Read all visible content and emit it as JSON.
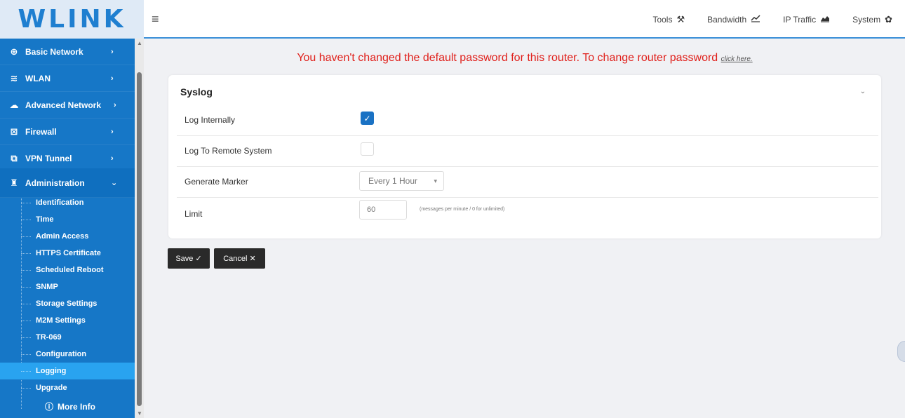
{
  "header": {
    "logo": "WLINK",
    "nav": [
      {
        "label": "Tools",
        "icon": "tools-icon",
        "glyph": "⚒"
      },
      {
        "label": "Bandwidth",
        "icon": "line-chart-icon",
        "glyph": "📈"
      },
      {
        "label": "IP Traffic",
        "icon": "area-chart-icon",
        "glyph": "▟"
      },
      {
        "label": "System",
        "icon": "gear-icon",
        "glyph": "✿"
      }
    ]
  },
  "sidebar": {
    "items": [
      {
        "label": "Basic Network",
        "icon": "globe-icon",
        "glyph": "⊕",
        "chevron": "›"
      },
      {
        "label": "WLAN",
        "icon": "wifi-icon",
        "glyph": "≋",
        "chevron": "›"
      },
      {
        "label": "Advanced Network",
        "icon": "network-icon",
        "glyph": "☁",
        "chevron": "›"
      },
      {
        "label": "Firewall",
        "icon": "firewall-icon",
        "glyph": "⊠",
        "chevron": "›"
      },
      {
        "label": "VPN Tunnel",
        "icon": "vpn-icon",
        "glyph": "⧉",
        "chevron": "›"
      },
      {
        "label": "Administration",
        "icon": "admin-icon",
        "glyph": "♜",
        "chevron": "⌄"
      }
    ],
    "subitems": [
      "Identification",
      "Time",
      "Admin Access",
      "HTTPS Certificate",
      "Scheduled Reboot",
      "SNMP",
      "Storage Settings",
      "M2M Settings",
      "TR-069",
      "Configuration",
      "Logging",
      "Upgrade"
    ],
    "selected_subitem": "Logging",
    "more_info": "More Info"
  },
  "warning": {
    "text": "You haven't changed the default password for this router. To change router password",
    "link": "click here."
  },
  "syslog": {
    "title": "Syslog",
    "log_internally": {
      "label": "Log Internally",
      "checked": true
    },
    "log_remote": {
      "label": "Log To Remote System",
      "checked": false
    },
    "generate_marker": {
      "label": "Generate Marker",
      "value": "Every 1 Hour"
    },
    "limit": {
      "label": "Limit",
      "value": "60",
      "hint": "(messages per minute / 0 for unlimited)"
    }
  },
  "buttons": {
    "save": "Save ✓",
    "cancel": "Cancel ✕"
  },
  "colors": {
    "sidebar": "#1677c7",
    "selected": "#29a3f0",
    "warning": "#e0201b",
    "accent": "#1a72c4"
  }
}
